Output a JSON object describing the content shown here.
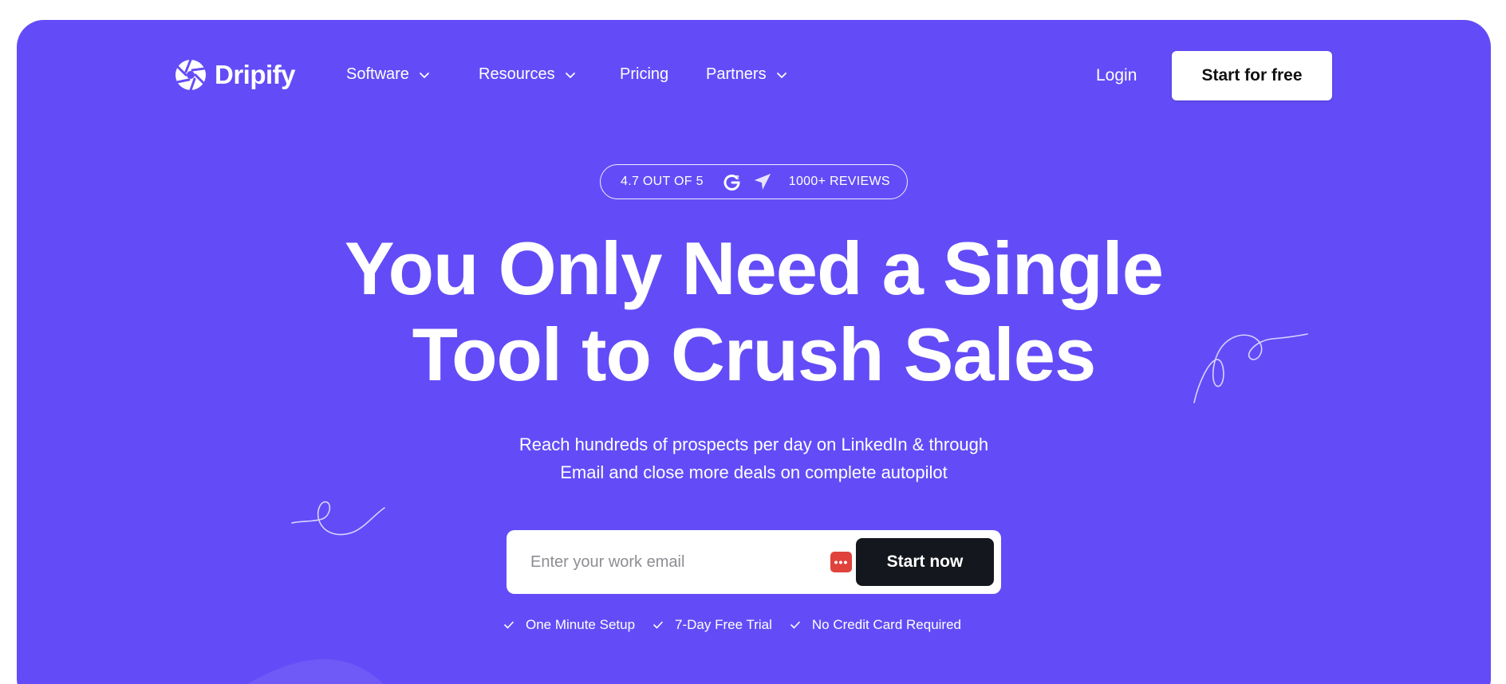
{
  "brand": {
    "name": "Dripify",
    "color": "#634cf7",
    "logo_icon": "aperture-icon"
  },
  "nav": {
    "items": [
      {
        "label": "Software",
        "has_dropdown": true
      },
      {
        "label": "Resources",
        "has_dropdown": true
      },
      {
        "label": "Pricing",
        "has_dropdown": false
      },
      {
        "label": "Partners",
        "has_dropdown": true
      }
    ],
    "login_label": "Login",
    "cta_label": "Start for free"
  },
  "rating": {
    "score_text": "4.7 OUT OF 5",
    "reviews_text": "1000+ REVIEWS",
    "icons": [
      "g2-icon",
      "capterra-icon"
    ]
  },
  "hero": {
    "headline_line1": "You Only Need a Single",
    "headline_line2": "Tool to Crush Sales",
    "subtext_line1": "Reach hundreds of prospects per day on LinkedIn & through",
    "subtext_line2": "Email and close more deals on complete autopilot"
  },
  "form": {
    "email_placeholder": "Enter your work email",
    "email_value": "",
    "submit_label": "Start now",
    "password_manager_icon": "password-manager-icon",
    "password_manager_glyph": "•••"
  },
  "features": [
    {
      "label": "One Minute Setup",
      "icon": "check-icon"
    },
    {
      "label": "7-Day Free Trial",
      "icon": "check-icon"
    },
    {
      "label": "No Credit Card Required",
      "icon": "check-icon"
    }
  ],
  "colors": {
    "hero_bg": "#634cf7",
    "button_dark": "#15171e",
    "password_icon": "#e0423c"
  }
}
